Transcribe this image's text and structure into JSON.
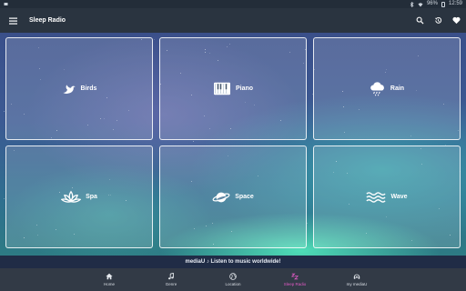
{
  "status_bar": {
    "battery": "96%",
    "time": "12:59"
  },
  "app_bar": {
    "title": "Sleep Radio",
    "icons": [
      "menu-icon",
      "search-icon",
      "history-icon",
      "heart-icon"
    ]
  },
  "tiles": [
    {
      "label": "Birds",
      "icon": "bird-icon"
    },
    {
      "label": "Piano",
      "icon": "piano-icon"
    },
    {
      "label": "Rain",
      "icon": "rain-cloud-icon"
    },
    {
      "label": "Spa",
      "icon": "lotus-icon"
    },
    {
      "label": "Space",
      "icon": "planet-icon"
    },
    {
      "label": "Wave",
      "icon": "wave-icon"
    }
  ],
  "banner": {
    "text": "mediaU ♪ Listen to music worldwide!"
  },
  "bottom_nav": {
    "active": "Sleep Radio",
    "active_color": "#e25ac5",
    "items": [
      {
        "label": "Home",
        "icon": "home-icon"
      },
      {
        "label": "Genre",
        "icon": "music-note-icon"
      },
      {
        "label": "Location",
        "icon": "globe-icon"
      },
      {
        "label": "Sleep Radio",
        "icon": "sleep-zz-icon"
      },
      {
        "label": "my mediaU",
        "icon": "headphones-user-icon"
      }
    ]
  }
}
